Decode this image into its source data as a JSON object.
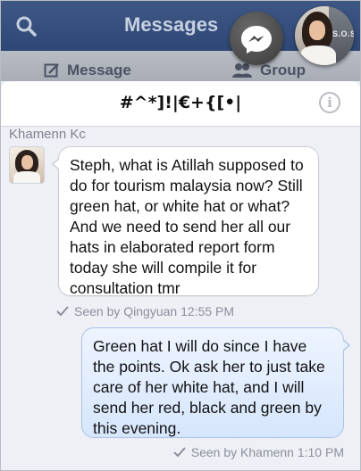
{
  "topbar": {
    "title": "Messages",
    "tabs": [
      {
        "label": "Message",
        "icon": "compose-icon"
      },
      {
        "label": "Group",
        "icon": "group-icon"
      }
    ]
  },
  "conversation": {
    "title": "#^*]!|€+{[•|"
  },
  "messages": [
    {
      "direction": "incoming",
      "sender": "Khamenn Kc",
      "text": "Steph, what is Atillah supposed to do for tourism malaysia now? Still green hat, or white hat or what? And we need to send her all our hats in elaborated report form today she will compile it for consultation tmr",
      "receipt": "Seen by Qingyuan 12:55 PM"
    },
    {
      "direction": "outgoing",
      "text": "Green hat I will do since I have the points. Ok ask her to just take care of her white hat, and I will send her red, black and green by this evening.",
      "receipt": "Seen by Khamenn 1:10 PM"
    }
  ],
  "chatheads": {
    "user_badge_text": "S.O.S"
  },
  "colors": {
    "nav_blue": "#2f4775",
    "outgoing_bubble": "#d6e6fc",
    "incoming_bubble": "#ffffff"
  }
}
